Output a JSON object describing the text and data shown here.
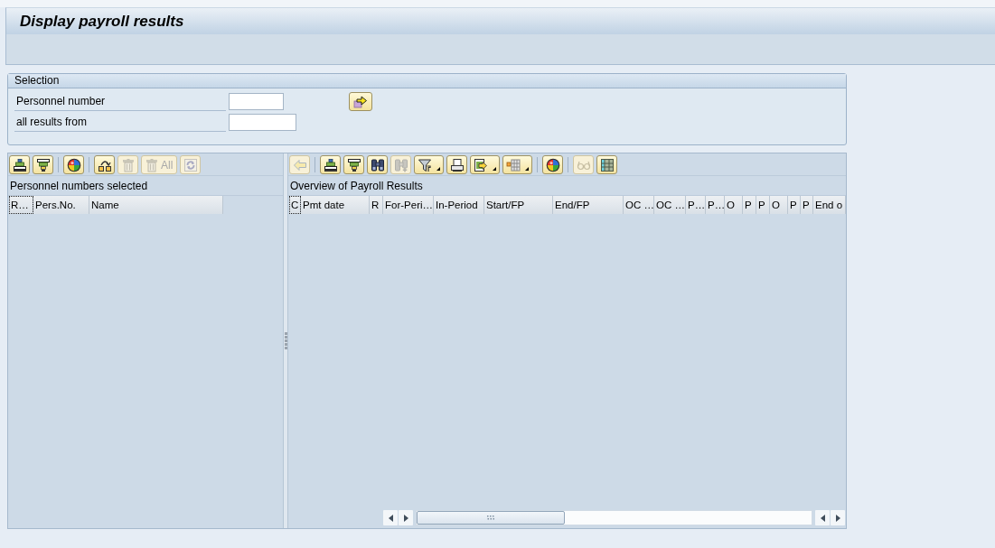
{
  "header": {
    "title": "Display payroll results"
  },
  "selection": {
    "title": "Selection",
    "fields": [
      {
        "label": "Personnel number"
      },
      {
        "label": "all results from"
      }
    ]
  },
  "left_pane": {
    "toolbar": [
      {
        "buttons": [
          {
            "kind": "sortup",
            "disabled": false,
            "dropdown": false
          },
          {
            "kind": "sortdown",
            "disabled": false,
            "dropdown": false
          }
        ]
      },
      {
        "buttons": [
          {
            "kind": "colors",
            "disabled": false,
            "dropdown": false
          }
        ]
      },
      {
        "buttons": [
          {
            "kind": "swap",
            "disabled": false,
            "dropdown": false
          },
          {
            "kind": "delete",
            "disabled": true,
            "dropdown": false
          },
          {
            "kind": "delete",
            "label": "All",
            "disabled": true,
            "dropdown": false
          },
          {
            "kind": "refresh",
            "disabled": true,
            "dropdown": false
          }
        ]
      }
    ],
    "title": "Personnel numbers selected",
    "columns": [
      {
        "label": "R…",
        "focused": true
      },
      {
        "label": "Pers.No.",
        "focused": false
      },
      {
        "label": "Name",
        "focused": false
      }
    ]
  },
  "right_pane": {
    "toolbar": [
      {
        "buttons": [
          {
            "kind": "back",
            "disabled": true,
            "dropdown": false
          }
        ]
      },
      {
        "buttons": [
          {
            "kind": "sortup",
            "disabled": false,
            "dropdown": false
          },
          {
            "kind": "sortdown",
            "disabled": false,
            "dropdown": false
          },
          {
            "kind": "find",
            "disabled": false,
            "dropdown": false
          },
          {
            "kind": "findnext",
            "disabled": true,
            "dropdown": false
          },
          {
            "kind": "filter",
            "disabled": false,
            "dropdown": true
          },
          {
            "kind": "print",
            "disabled": false,
            "dropdown": false
          },
          {
            "kind": "export",
            "disabled": false,
            "dropdown": true
          },
          {
            "kind": "layout",
            "disabled": false,
            "dropdown": true
          }
        ]
      },
      {
        "buttons": [
          {
            "kind": "colors",
            "disabled": false,
            "dropdown": false
          }
        ]
      },
      {
        "buttons": [
          {
            "kind": "details",
            "disabled": true,
            "dropdown": false
          },
          {
            "kind": "grid",
            "disabled": false,
            "dropdown": false
          }
        ]
      }
    ],
    "title": "Overview of Payroll Results",
    "columns": [
      {
        "label": "C",
        "focused": true
      },
      {
        "label": "Pmt date",
        "focused": false
      },
      {
        "label": "R",
        "focused": false
      },
      {
        "label": "For-Peri…",
        "focused": false
      },
      {
        "label": "In-Period",
        "focused": false
      },
      {
        "label": "Start/FP",
        "focused": false
      },
      {
        "label": "End/FP",
        "focused": false
      },
      {
        "label": "OC …",
        "focused": false
      },
      {
        "label": "OC …",
        "focused": false
      },
      {
        "label": "P…",
        "focused": false
      },
      {
        "label": "P…",
        "focused": false
      },
      {
        "label": "O",
        "focused": false
      },
      {
        "label": "P",
        "focused": false
      },
      {
        "label": "P",
        "focused": false
      },
      {
        "label": "O",
        "focused": false
      },
      {
        "label": "P",
        "focused": false
      },
      {
        "label": "P",
        "focused": false
      },
      {
        "label": "End o",
        "focused": false
      }
    ]
  }
}
